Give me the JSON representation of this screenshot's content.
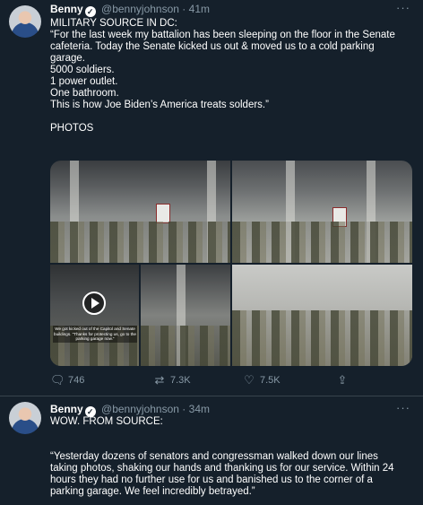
{
  "tweet1": {
    "name": "Benny",
    "handle": "@bennyjohnson",
    "dot": "·",
    "time": "41m",
    "lines": [
      "MILITARY SOURCE IN DC:",
      "“For the last week my battalion has been sleeping on the floor in the Senate",
      "cafeteria. Today the Senate kicked us out & moved us to a cold parking",
      "garage.",
      "5000 soldiers.",
      "1 power outlet.",
      "One bathroom.",
      "This is how Joe Biden’s America treats solders.”",
      "",
      "PHOTOS"
    ],
    "video_caption": "We got kicked out of the Capitol and Senate buildings. “Thanks for protecting us, go to the parking garage now.”",
    "actions": {
      "reply": "746",
      "retweet": "7.3K",
      "like": "7.5K"
    }
  },
  "tweet2": {
    "name": "Benny",
    "handle": "@bennyjohnson",
    "dot": "·",
    "time": "34m",
    "lines": [
      "WOW. FROM SOURCE:",
      "",
      "",
      "“Yesterday dozens of senators and congressman walked down our lines",
      "taking photos, shaking our hands and thanking us for our service. Within 24",
      "hours they had no further use for us and banished us to the corner of a",
      "parking garage. We feel incredibly betrayed.”"
    ]
  },
  "icons": {
    "more": "···",
    "verified": "✓",
    "reply": "reply-icon",
    "retweet": "retweet-icon",
    "like": "heart-icon",
    "share": "share-icon"
  },
  "colors": {
    "background": "#15202b",
    "secondary_text": "#8899a6",
    "divider": "#38444d"
  }
}
